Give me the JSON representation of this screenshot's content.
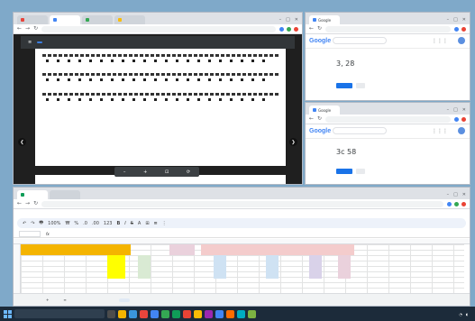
{
  "pdf_window": {
    "tabs": [
      "",
      "",
      "",
      ""
    ],
    "nav": {
      "back": "←",
      "forward": "→",
      "reload": "↻",
      "home": "⌂"
    },
    "url": "",
    "pdf_name": "",
    "page_indicator": "",
    "controls": {
      "minimize": "–",
      "maximize": "□",
      "close": "✕",
      "left_arrow": "❮",
      "right_arrow": "❯",
      "zoom_out": "–",
      "zoom_in": "+",
      "fit": "⊡",
      "rotate": "⟳"
    }
  },
  "google_top": {
    "tabs": [
      "Google",
      "",
      "",
      ""
    ],
    "logo": "Google",
    "search_value": "",
    "tool_text": "3, 28",
    "controls": {
      "minimize": "–",
      "maximize": "□",
      "close": "✕",
      "apps": "⋮⋮⋮"
    }
  },
  "google_bottom": {
    "tabs": [
      "Google",
      "",
      "",
      ""
    ],
    "logo": "Google",
    "search_value": "",
    "tool_text": "3c 58",
    "controls": {
      "minimize": "–",
      "maximize": "□",
      "close": "✕",
      "apps": "⋮⋮⋮"
    }
  },
  "sheets_window": {
    "tabs": [
      "",
      ""
    ],
    "url": "",
    "menu": [
      "",
      "",
      "",
      "",
      "",
      "",
      "",
      "",
      ""
    ],
    "toolbar": [
      "↶",
      "↷",
      "🖶",
      "100%",
      "₩",
      "%",
      ".0",
      ".00",
      "123",
      "B",
      "I",
      "S",
      "A",
      "⊞",
      "≣",
      "⋮"
    ],
    "name_box": "",
    "formula_prefix": "fx",
    "cells": {
      "title": "",
      "r1": "",
      "r2": "",
      "r3": "",
      "r4": "",
      "r5": ""
    },
    "sheet_tabs": [
      "+",
      "≡",
      "",
      "",
      "",
      ""
    ],
    "active_sheet_index": 5
  },
  "taskbar": {
    "search_placeholder": "",
    "time": "",
    "date": ""
  },
  "colors": {
    "chrome_tab_strip": "#dee1e6",
    "pdf_toolbar": "#323639",
    "accent_blue": "#1a73e8",
    "sheet_title_fill": "#f4b400",
    "sheet_yellow": "#ffff00",
    "taskbar": "#1c2b3a"
  }
}
